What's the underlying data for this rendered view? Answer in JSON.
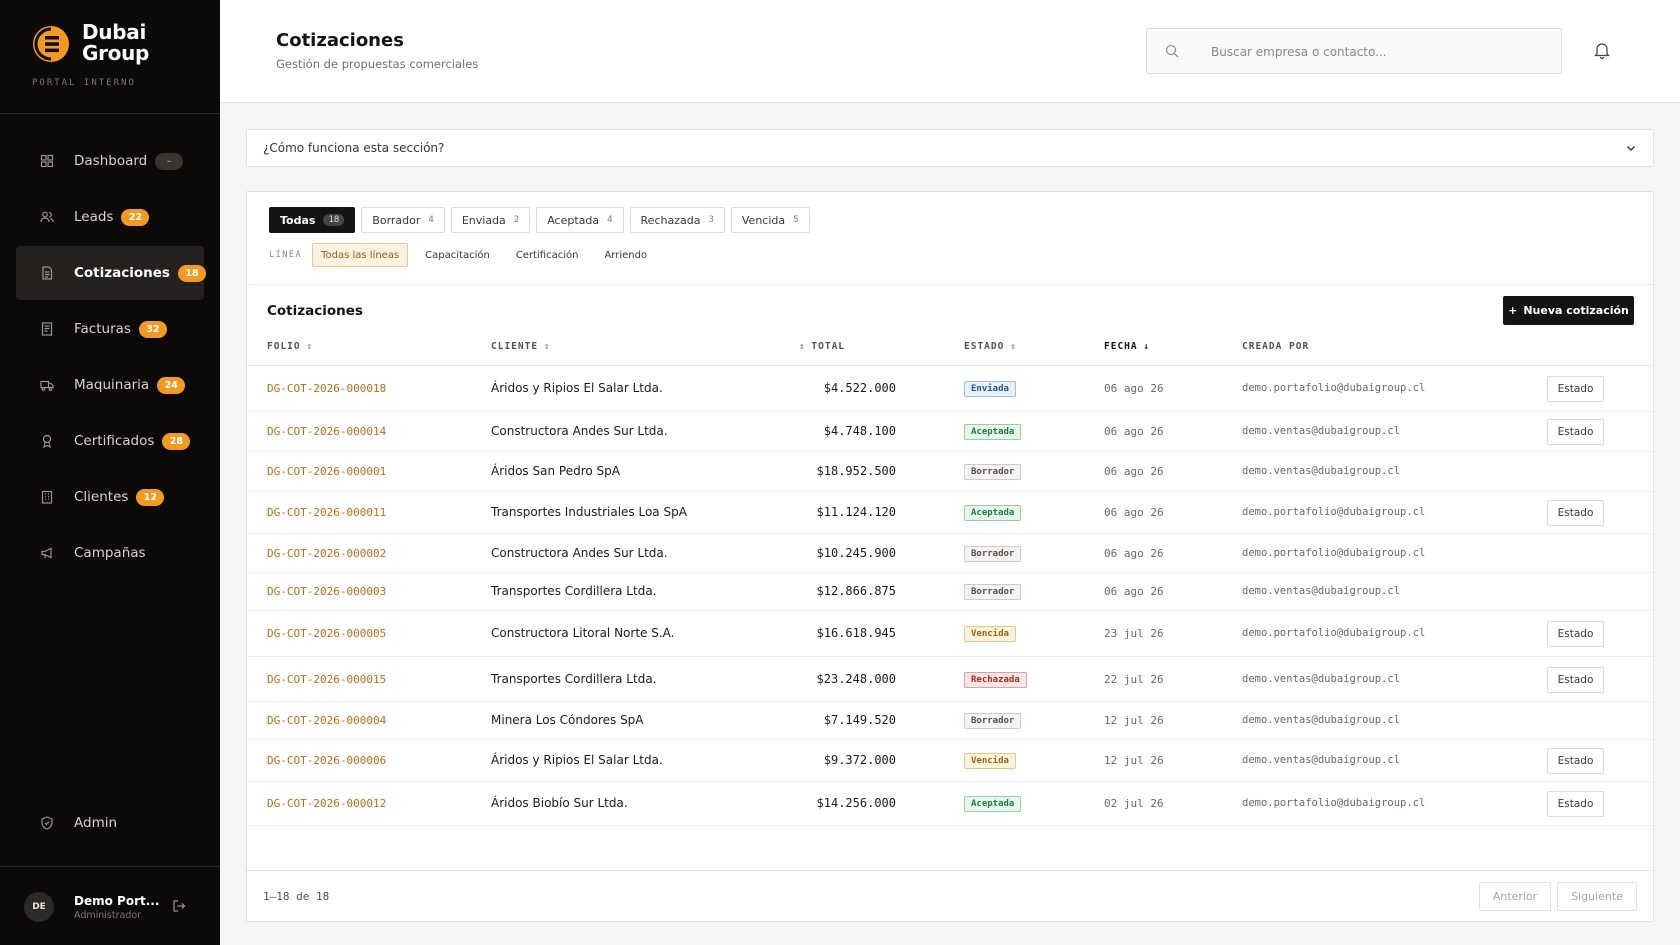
{
  "brand": {
    "name_line1": "Dubai",
    "name_line2": "Group",
    "subtitle": "PORTAL INTERNO",
    "accent": "#f39a1f"
  },
  "sidebar": {
    "items": [
      {
        "label": "Dashboard",
        "badge": "–",
        "icon": "grid-icon"
      },
      {
        "label": "Leads",
        "badge": "22",
        "icon": "users-icon"
      },
      {
        "label": "Cotizaciones",
        "badge": "18",
        "icon": "document-icon",
        "active": true
      },
      {
        "label": "Facturas",
        "badge": "32",
        "icon": "invoice-icon"
      },
      {
        "label": "Maquinaria",
        "badge": "24",
        "icon": "truck-icon"
      },
      {
        "label": "Certificados",
        "badge": "28",
        "icon": "award-icon"
      },
      {
        "label": "Clientes",
        "badge": "12",
        "icon": "building-icon"
      },
      {
        "label": "Campañas",
        "badge": "",
        "icon": "megaphone-icon"
      }
    ],
    "admin": {
      "label": "Admin",
      "icon": "shield-icon"
    },
    "user": {
      "initials": "DE",
      "name": "Demo Port...",
      "role": "Administrador"
    }
  },
  "header": {
    "title": "Cotizaciones",
    "subtitle": "Gestión de propuestas comerciales",
    "search_placeholder": "Buscar empresa o contacto..."
  },
  "help": {
    "label": "¿Cómo funciona esta sección?"
  },
  "tabs": [
    {
      "label": "Todas",
      "count": "18",
      "active": true
    },
    {
      "label": "Borrador",
      "count": "4"
    },
    {
      "label": "Enviada",
      "count": "2"
    },
    {
      "label": "Aceptada",
      "count": "4"
    },
    {
      "label": "Rechazada",
      "count": "3"
    },
    {
      "label": "Vencida",
      "count": "5"
    }
  ],
  "lines": {
    "label": "LÍNEA",
    "options": [
      "Todas las líneas",
      "Capacitación",
      "Certificación",
      "Arriendo"
    ],
    "selected": "Todas las líneas"
  },
  "table": {
    "title": "Cotizaciones",
    "new_button": "Nueva cotización",
    "columns": {
      "folio": "FOLIO",
      "cliente": "CLIENTE",
      "total": "TOTAL",
      "estado": "ESTADO",
      "fecha": "FECHA",
      "creada_por": "CREADA POR"
    },
    "action_label": "Estado",
    "rows": [
      {
        "folio": "DG-COT-2026-000018",
        "cliente": "Áridos y Ripios El Salar Ltda.",
        "total": "$4.522.000",
        "estado": "Enviada",
        "fecha": "06 ago 26",
        "creada_por": "demo.portafolio@dubaigroup.cl",
        "action": true
      },
      {
        "folio": "DG-COT-2026-000014",
        "cliente": "Constructora Andes Sur Ltda.",
        "total": "$4.748.100",
        "estado": "Aceptada",
        "fecha": "06 ago 26",
        "creada_por": "demo.ventas@dubaigroup.cl",
        "action": true
      },
      {
        "folio": "DG-COT-2026-000001",
        "cliente": "Áridos San Pedro SpA",
        "total": "$18.952.500",
        "estado": "Borrador",
        "fecha": "06 ago 26",
        "creada_por": "demo.ventas@dubaigroup.cl",
        "action": false
      },
      {
        "folio": "DG-COT-2026-000011",
        "cliente": "Transportes Industriales Loa SpA",
        "total": "$11.124.120",
        "estado": "Aceptada",
        "fecha": "06 ago 26",
        "creada_por": "demo.portafolio@dubaigroup.cl",
        "action": true
      },
      {
        "folio": "DG-COT-2026-000002",
        "cliente": "Constructora Andes Sur Ltda.",
        "total": "$10.245.900",
        "estado": "Borrador",
        "fecha": "06 ago 26",
        "creada_por": "demo.portafolio@dubaigroup.cl",
        "action": false
      },
      {
        "folio": "DG-COT-2026-000003",
        "cliente": "Transportes Cordillera Ltda.",
        "total": "$12.866.875",
        "estado": "Borrador",
        "fecha": "06 ago 26",
        "creada_por": "demo.ventas@dubaigroup.cl",
        "action": false
      },
      {
        "folio": "DG-COT-2026-000005",
        "cliente": "Constructora Litoral Norte S.A.",
        "total": "$16.618.945",
        "estado": "Vencida",
        "fecha": "23 jul 26",
        "creada_por": "demo.portafolio@dubaigroup.cl",
        "action": true
      },
      {
        "folio": "DG-COT-2026-000015",
        "cliente": "Transportes Cordillera Ltda.",
        "total": "$23.248.000",
        "estado": "Rechazada",
        "fecha": "22 jul 26",
        "creada_por": "demo.ventas@dubaigroup.cl",
        "action": true
      },
      {
        "folio": "DG-COT-2026-000004",
        "cliente": "Minera Los Cóndores SpA",
        "total": "$7.149.520",
        "estado": "Borrador",
        "fecha": "12 jul 26",
        "creada_por": "demo.ventas@dubaigroup.cl",
        "action": false
      },
      {
        "folio": "DG-COT-2026-000006",
        "cliente": "Áridos y Ripios El Salar Ltda.",
        "total": "$9.372.000",
        "estado": "Vencida",
        "fecha": "12 jul 26",
        "creada_por": "demo.ventas@dubaigroup.cl",
        "action": true
      },
      {
        "folio": "DG-COT-2026-000012",
        "cliente": "Áridos Biobío Sur Ltda.",
        "total": "$14.256.000",
        "estado": "Aceptada",
        "fecha": "02 jul 26",
        "creada_por": "demo.portafolio@dubaigroup.cl",
        "action": true
      }
    ]
  },
  "pagination": {
    "range": "1–18 de 18",
    "prev": "Anterior",
    "next": "Siguiente"
  }
}
